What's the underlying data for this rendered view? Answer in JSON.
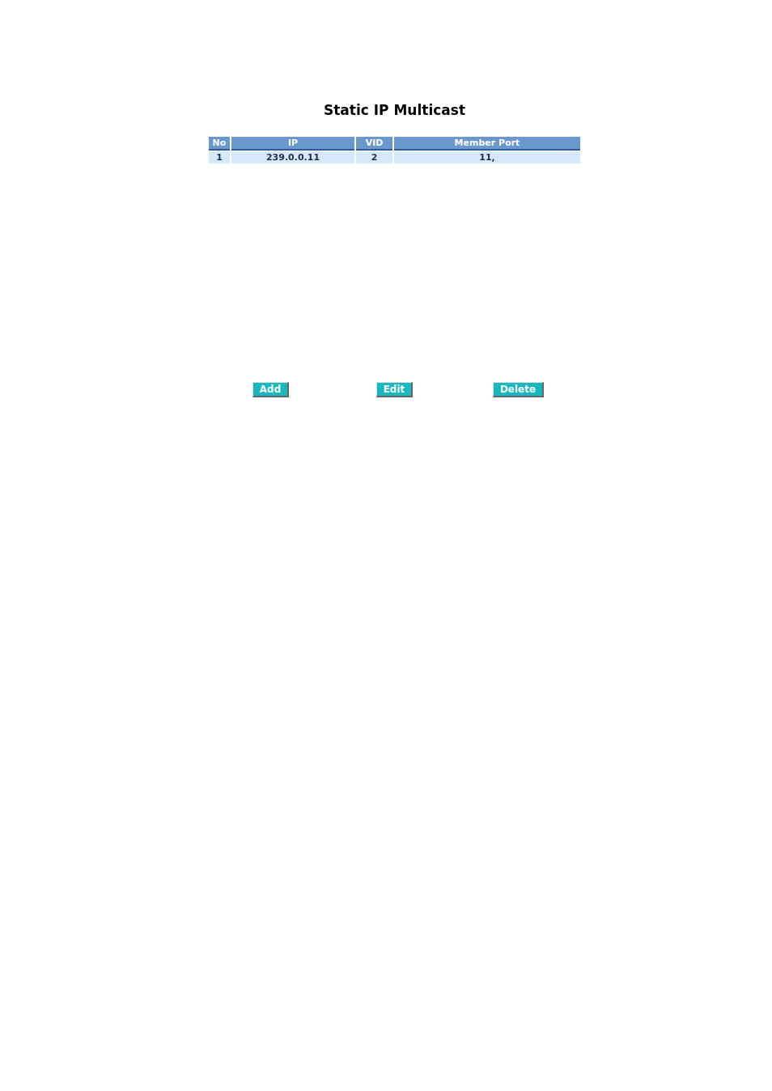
{
  "title": "Static IP Multicast",
  "table": {
    "columns": [
      "No",
      "IP",
      "VID",
      "Member Port"
    ],
    "rows": [
      [
        "1",
        "239.0.0.11",
        "2",
        "11,"
      ]
    ]
  },
  "buttons": [
    "Add",
    "Edit",
    "Delete"
  ]
}
